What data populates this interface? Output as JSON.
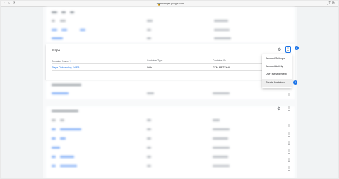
{
  "browser": {
    "url": "tagmanager.google.com",
    "left_controls": [
      "‹",
      "›",
      "↻"
    ],
    "right_controls": [
      "⤴",
      "⧉"
    ]
  },
  "container_card": {
    "account_name": "Stape",
    "columns": {
      "name": "Container Name",
      "type": "Container Type",
      "id": "Container ID"
    },
    "row": {
      "name": "Stape Onboarding - WEB",
      "type": "Web",
      "id": "GTM-MFZ3XH9"
    }
  },
  "menu": {
    "items": [
      "Account Settings",
      "Account Activity",
      "User Management",
      "Create Container"
    ]
  },
  "badges": {
    "first": "1",
    "second": "2"
  },
  "icons": {
    "gear": "⚙",
    "kebab": "⋮",
    "sort": "🡑"
  }
}
